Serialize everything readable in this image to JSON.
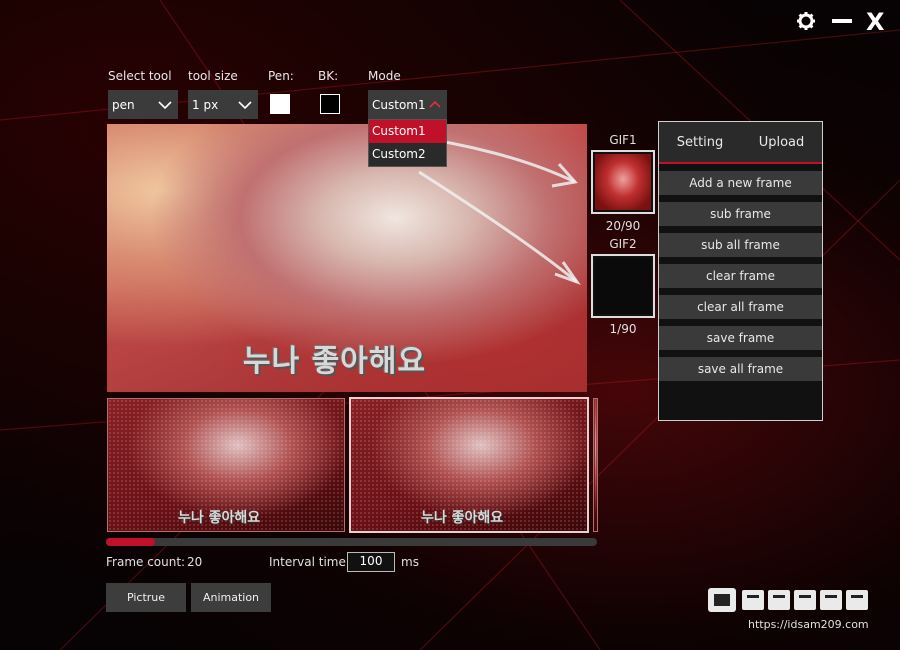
{
  "window": {
    "settings_icon": "gear-icon",
    "minimize_icon": "minimize-icon",
    "close_glyph": "X"
  },
  "toolbar": {
    "select_tool_label": "Select tool",
    "select_tool_value": "pen",
    "tool_size_label": "tool size",
    "tool_size_value": "1 px",
    "pen_label": "Pen:",
    "pen_color": "#ffffff",
    "bk_label": "BK:",
    "bk_color": "#000000",
    "mode_label": "Mode",
    "mode_value": "Custom1",
    "mode_options": [
      "Custom1",
      "Custom2"
    ]
  },
  "canvas": {
    "caption": "누나 좋아해요"
  },
  "frames": {
    "items": [
      {
        "caption": "누나 좋아해요"
      },
      {
        "caption": "누나 좋아해요"
      }
    ],
    "progress": 0.1
  },
  "gifs": [
    {
      "label": "GIF1",
      "counter": "20/90"
    },
    {
      "label": "GIF2",
      "counter": "1/90"
    }
  ],
  "panel": {
    "tabs": [
      "Setting",
      "Upload"
    ],
    "buttons": [
      "Add a new frame",
      "sub frame",
      "sub all frame",
      "clear frame",
      "clear all frame",
      "save frame",
      "save all frame"
    ]
  },
  "footer": {
    "frame_count_label": "Frame count:",
    "frame_count_value": "20",
    "interval_label": "Interval time:",
    "interval_value": "100",
    "interval_unit": "ms",
    "picture_button": "Pictrue",
    "animation_button": "Animation"
  },
  "watermark": {
    "url": "https://idsam209.com"
  },
  "colors": {
    "accent": "#c0102a",
    "panel_border": "#cfcfcf"
  }
}
